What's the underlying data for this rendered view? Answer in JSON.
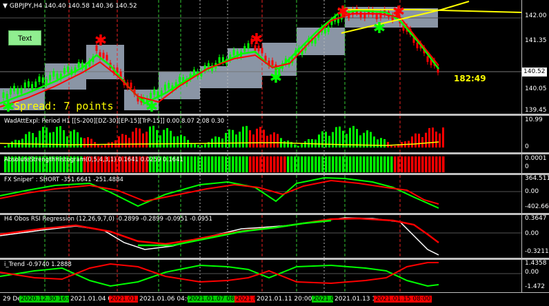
{
  "chart": {
    "title": "GBPJPY,H4  140.40 140.58 140.36 140.52",
    "text_button": "Text",
    "spread_text": "Spread: 7 points",
    "timer": "182:49",
    "current_price": "140.52",
    "price_ticks": [
      "142.00",
      "141.35",
      "140.70",
      "140.05",
      "139.45"
    ]
  },
  "panels": [
    {
      "label": "WadAttExpl: Period H1 [[S-200][DZ-30][EP-15][TrP-15]] 0.00 8.07 2.08 0.30",
      "ticks": [
        "10.99",
        "0"
      ]
    },
    {
      "label": "AbsoluteStrengthHistogram(0,5,4,3,1) 0.1641 0.0259 0.1641",
      "ticks": [
        "0.0001",
        "0"
      ]
    },
    {
      "label": "FX Sniper' : SHORT -351.6641 -251.4884",
      "ticks": [
        "364.5119",
        "0.00",
        "-402.6642"
      ]
    },
    {
      "label": "H4 Obos RSI Regression (12,26,9,7,0) -0.2899 -0.2899 -0.0951 -0.0951",
      "ticks": [
        "0.3647",
        "0.00",
        "-0.3211"
      ]
    },
    {
      "label": "i_Trend -0.9740 1.2888",
      "ticks": [
        "1.4358",
        "0.00",
        "-1.472"
      ]
    }
  ],
  "time_axis": [
    {
      "text": "29 Dec 2020",
      "color": "#ffffff",
      "bg": "#000000"
    },
    {
      "text": "2020.12.30 16:00",
      "color": "#000000",
      "bg": "#00cc00"
    },
    {
      "text": "2021.01.04 04:00",
      "color": "#ffffff",
      "bg": "#000000"
    },
    {
      "text": "2021.01.05 12:00",
      "color": "#000000",
      "bg": "#ff0000"
    },
    {
      "text": "2021.01.06 04:00",
      "color": "#ffffff",
      "bg": "#000000"
    },
    {
      "text": "2021.01.07 08:00",
      "color": "#000000",
      "bg": "#00cc00"
    },
    {
      "text": "2021.01.08 12:00",
      "color": "#000000",
      "bg": "#ff0000"
    },
    {
      "text": "2021.01.11 20:00",
      "color": "#ffffff",
      "bg": "#000000"
    },
    {
      "text": "2021.01.12 08:00",
      "color": "#000000",
      "bg": "#00cc00"
    },
    {
      "text": "2021.01.13 16:00",
      "color": "#ffffff",
      "bg": "#000000"
    },
    {
      "text": "2021.01.15 08:00",
      "color": "#000000",
      "bg": "#ff0000"
    }
  ],
  "colors": {
    "bull": "#00ff00",
    "bear": "#ff0000",
    "box": "#8a95a5",
    "trend": "#ffff00",
    "white": "#ffffff"
  }
}
